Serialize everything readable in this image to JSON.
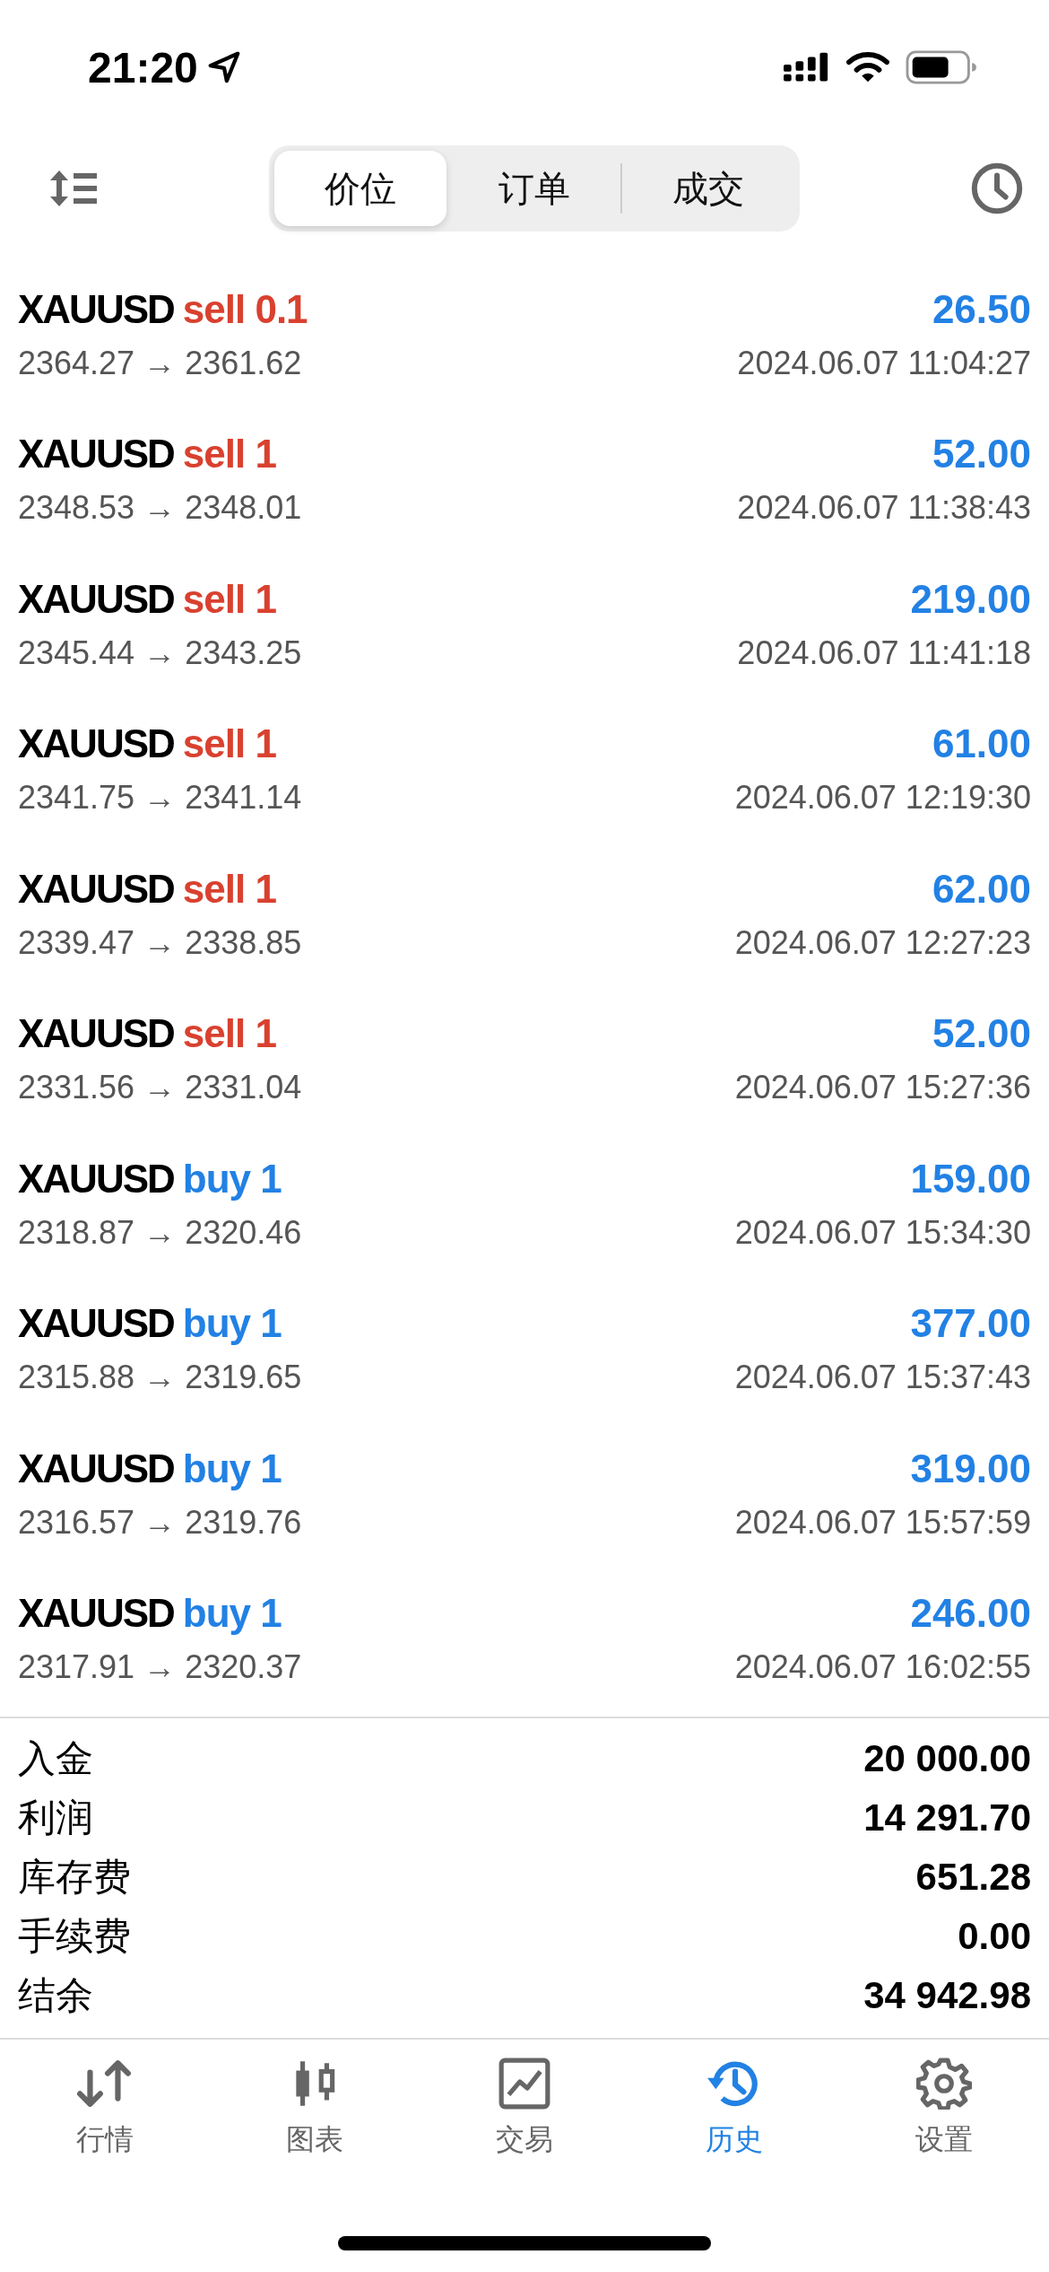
{
  "status_bar": {
    "time": "21:20"
  },
  "segments": [
    {
      "label": "价位",
      "selected": true
    },
    {
      "label": "订单",
      "selected": false
    },
    {
      "label": "成交",
      "selected": false
    }
  ],
  "deals": [
    {
      "symbol": "XAUUSD",
      "kind": "sell",
      "order": "sell 0.1",
      "profit": "26.50",
      "prices": "2364.27 → 2361.62",
      "time": "2024.06.07 11:04:27"
    },
    {
      "symbol": "XAUUSD",
      "kind": "sell",
      "order": "sell 1",
      "profit": "52.00",
      "prices": "2348.53 → 2348.01",
      "time": "2024.06.07 11:38:43"
    },
    {
      "symbol": "XAUUSD",
      "kind": "sell",
      "order": "sell 1",
      "profit": "219.00",
      "prices": "2345.44 → 2343.25",
      "time": "2024.06.07 11:41:18"
    },
    {
      "symbol": "XAUUSD",
      "kind": "sell",
      "order": "sell 1",
      "profit": "61.00",
      "prices": "2341.75 → 2341.14",
      "time": "2024.06.07 12:19:30"
    },
    {
      "symbol": "XAUUSD",
      "kind": "sell",
      "order": "sell 1",
      "profit": "62.00",
      "prices": "2339.47 → 2338.85",
      "time": "2024.06.07 12:27:23"
    },
    {
      "symbol": "XAUUSD",
      "kind": "sell",
      "order": "sell 1",
      "profit": "52.00",
      "prices": "2331.56 → 2331.04",
      "time": "2024.06.07 15:27:36"
    },
    {
      "symbol": "XAUUSD",
      "kind": "buy",
      "order": "buy 1",
      "profit": "159.00",
      "prices": "2318.87 → 2320.46",
      "time": "2024.06.07 15:34:30"
    },
    {
      "symbol": "XAUUSD",
      "kind": "buy",
      "order": "buy 1",
      "profit": "377.00",
      "prices": "2315.88 → 2319.65",
      "time": "2024.06.07 15:37:43"
    },
    {
      "symbol": "XAUUSD",
      "kind": "buy",
      "order": "buy 1",
      "profit": "319.00",
      "prices": "2316.57 → 2319.76",
      "time": "2024.06.07 15:57:59"
    },
    {
      "symbol": "XAUUSD",
      "kind": "buy",
      "order": "buy 1",
      "profit": "246.00",
      "prices": "2317.91 → 2320.37",
      "time": "2024.06.07 16:02:55"
    }
  ],
  "summary": [
    {
      "label": "入金",
      "value": "20 000.00"
    },
    {
      "label": "利润",
      "value": "14 291.70"
    },
    {
      "label": "库存费",
      "value": "651.28"
    },
    {
      "label": "手续费",
      "value": "0.00"
    },
    {
      "label": "结余",
      "value": "34 942.98"
    }
  ],
  "tab_bar": [
    {
      "kind": "quotes",
      "label": "行情",
      "selected": false
    },
    {
      "kind": "chart",
      "label": "图表",
      "selected": false
    },
    {
      "kind": "trade",
      "label": "交易",
      "selected": false
    },
    {
      "kind": "history",
      "label": "历史",
      "selected": true
    },
    {
      "kind": "settings",
      "label": "设置",
      "selected": false
    }
  ]
}
